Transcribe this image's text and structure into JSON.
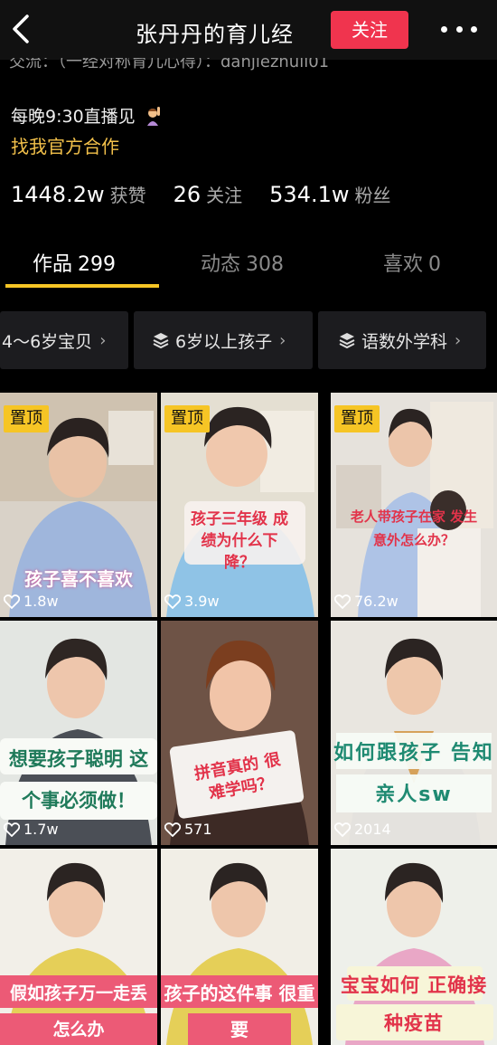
{
  "header": {
    "title": "张丹丹的育儿经",
    "follow_label": "关注",
    "cut_line": "交流：（一经对称育儿心得）：danjiezhuli01"
  },
  "profile": {
    "live_text": "每晚9:30直播见",
    "coop_link": "找我官方合作",
    "stats": [
      {
        "num": "1448.2w",
        "label": "获赞"
      },
      {
        "num": "26",
        "label": "关注"
      },
      {
        "num": "534.1w",
        "label": "粉丝"
      }
    ]
  },
  "tabs": [
    {
      "label": "作品",
      "count": "299",
      "active": true
    },
    {
      "label": "动态",
      "count": "308",
      "active": false
    },
    {
      "label": "喜欢",
      "count": "0",
      "active": false
    }
  ],
  "chips": [
    {
      "label": "4～6岁宝贝"
    },
    {
      "label": "6岁以上孩子"
    },
    {
      "label": "语数外学科"
    }
  ],
  "videos": [
    {
      "pinned": true,
      "pin_label": "置顶",
      "caption": "孩子喜不喜欢",
      "likes": "1.8w"
    },
    {
      "pinned": true,
      "pin_label": "置顶",
      "caption": "孩子三年级 成绩为什么下降？",
      "likes": "3.9w"
    },
    {
      "pinned": true,
      "pin_label": "置顶",
      "caption": "老人带孩子在家 发生意外怎么办？",
      "likes": "76.2w"
    },
    {
      "pinned": false,
      "caption": "想要孩子聪明 这个事必须做！",
      "likes": "1.7w"
    },
    {
      "pinned": false,
      "caption": "拼音真的 很难学吗？",
      "likes": "571"
    },
    {
      "pinned": false,
      "caption": "如何跟孩子 告知亲人sw",
      "likes": "2014"
    },
    {
      "pinned": false,
      "caption": "假如孩子万一走丢 怎么办",
      "likes": ""
    },
    {
      "pinned": false,
      "caption": "孩子的这件事 很重要",
      "likes": ""
    },
    {
      "pinned": false,
      "caption": "宝宝如何 正确接种疫苗",
      "likes": ""
    }
  ],
  "icons": {
    "back": "chevron-left-icon",
    "more": "more-dots-icon",
    "layers": "layers-icon",
    "heart": "heart-outline-icon"
  },
  "colors": {
    "accent_red": "#f0344e",
    "accent_yellow": "#f6c525",
    "coop_link": "#f2c04a"
  }
}
